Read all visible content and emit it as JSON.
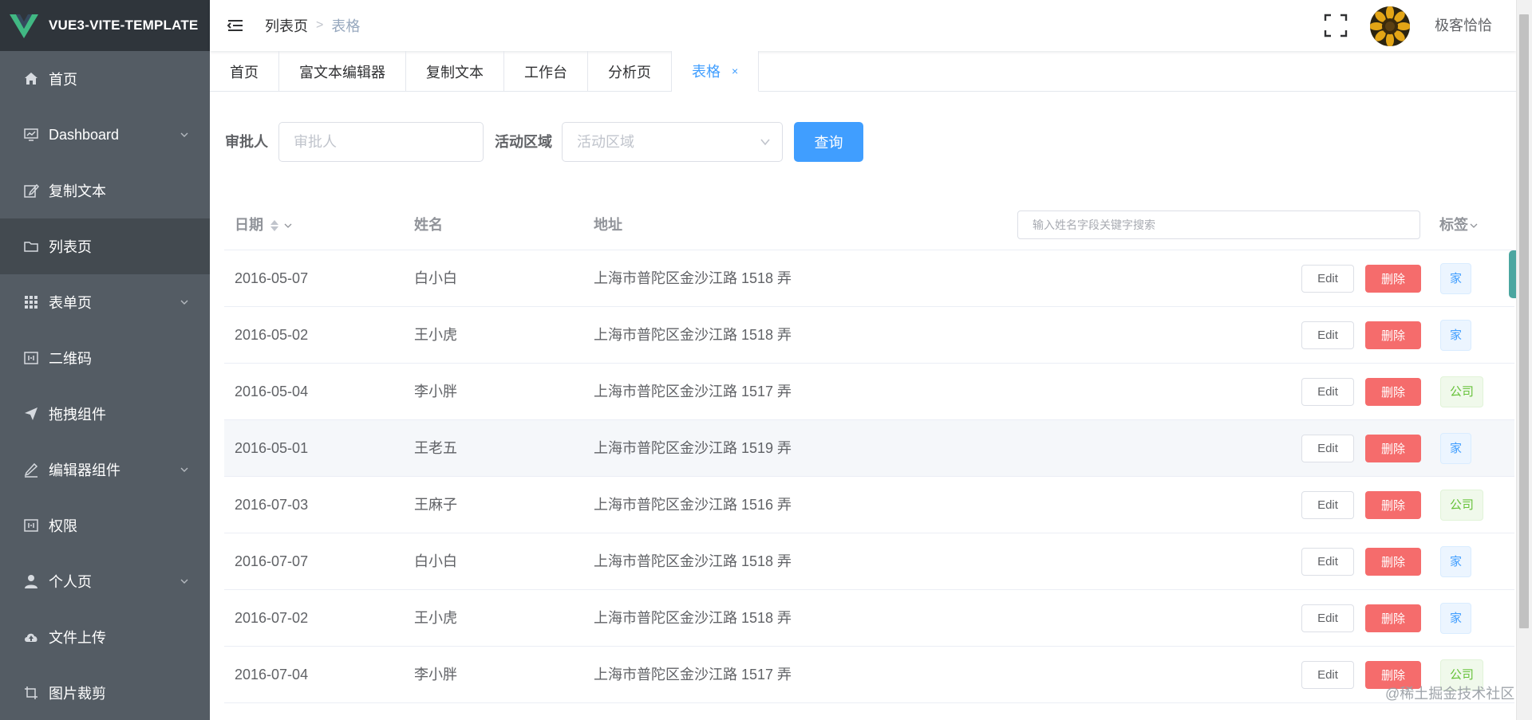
{
  "app": {
    "logo_text": "VUE3-VITE-TEMPLATE"
  },
  "sidebar": {
    "items": [
      {
        "label": "首页",
        "icon": "home-icon",
        "has_children": false
      },
      {
        "label": "Dashboard",
        "icon": "dashboard-icon",
        "has_children": true
      },
      {
        "label": "复制文本",
        "icon": "edit-icon",
        "has_children": false
      },
      {
        "label": "列表页",
        "icon": "folder-icon",
        "has_children": false,
        "active": true
      },
      {
        "label": "表单页",
        "icon": "grid-icon",
        "has_children": true
      },
      {
        "label": "二维码",
        "icon": "qrcode-icon",
        "has_children": false
      },
      {
        "label": "拖拽组件",
        "icon": "send-icon",
        "has_children": false
      },
      {
        "label": "编辑器组件",
        "icon": "pen-icon",
        "has_children": true
      },
      {
        "label": "权限",
        "icon": "lock-icon",
        "has_children": false
      },
      {
        "label": "个人页",
        "icon": "user-icon",
        "has_children": true
      },
      {
        "label": "文件上传",
        "icon": "upload-cloud-icon",
        "has_children": false
      },
      {
        "label": "图片裁剪",
        "icon": "crop-icon",
        "has_children": false
      }
    ]
  },
  "header": {
    "breadcrumb": [
      "列表页",
      "表格"
    ],
    "separator": ">",
    "username": "极客恰恰"
  },
  "tags": [
    {
      "label": "首页"
    },
    {
      "label": "富文本编辑器"
    },
    {
      "label": "复制文本"
    },
    {
      "label": "工作台"
    },
    {
      "label": "分析页"
    },
    {
      "label": "表格",
      "active": true,
      "close": "×"
    }
  ],
  "filter": {
    "approver_label": "审批人",
    "approver_placeholder": "审批人",
    "region_label": "活动区域",
    "region_placeholder": "活动区域",
    "query_button": "查询"
  },
  "table": {
    "columns": {
      "date": "日期",
      "name": "姓名",
      "address": "地址",
      "tag": "标签"
    },
    "search_placeholder": "输入姓名字段关键字搜索",
    "edit_label": "Edit",
    "delete_label": "删除",
    "rows": [
      {
        "date": "2016-05-07",
        "name": "白小白",
        "address": "上海市普陀区金沙江路 1518 弄",
        "tag": "家",
        "tag_type": "home"
      },
      {
        "date": "2016-05-02",
        "name": "王小虎",
        "address": "上海市普陀区金沙江路 1518 弄",
        "tag": "家",
        "tag_type": "home"
      },
      {
        "date": "2016-05-04",
        "name": "李小胖",
        "address": "上海市普陀区金沙江路 1517 弄",
        "tag": "公司",
        "tag_type": "company"
      },
      {
        "date": "2016-05-01",
        "name": "王老五",
        "address": "上海市普陀区金沙江路 1519 弄",
        "tag": "家",
        "tag_type": "home"
      },
      {
        "date": "2016-07-03",
        "name": "王麻子",
        "address": "上海市普陀区金沙江路 1516 弄",
        "tag": "公司",
        "tag_type": "company"
      },
      {
        "date": "2016-07-07",
        "name": "白小白",
        "address": "上海市普陀区金沙江路 1518 弄",
        "tag": "家",
        "tag_type": "home"
      },
      {
        "date": "2016-07-02",
        "name": "王小虎",
        "address": "上海市普陀区金沙江路 1518 弄",
        "tag": "家",
        "tag_type": "home"
      },
      {
        "date": "2016-07-04",
        "name": "李小胖",
        "address": "上海市普陀区金沙江路 1517 弄",
        "tag": "公司",
        "tag_type": "company"
      }
    ]
  },
  "watermark": "@稀土掘金技术社区",
  "colors": {
    "sidebar_bg": "#545c64",
    "logo_bg": "#2f353b",
    "primary": "#409eff",
    "danger": "#f56c6c",
    "success": "#67c23a"
  }
}
